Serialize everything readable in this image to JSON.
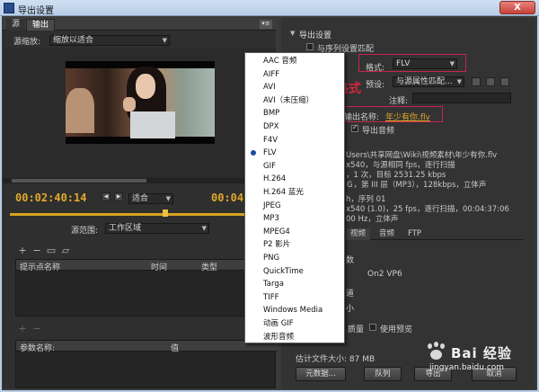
{
  "window": {
    "title": "导出设置",
    "close_label": "X"
  },
  "left": {
    "tabs": [
      "源",
      "输出"
    ],
    "source_scaling_label": "源缩放:",
    "source_scaling_value": "缩放以适合",
    "timecode_current": "00:02:40:14",
    "timecode_end": "00:04:",
    "fit_value": "适合",
    "source_range_label": "源范围:",
    "source_range_value": "工作区域",
    "cue_columns": [
      "提示点名称",
      "时间",
      "类型"
    ],
    "param_columns": [
      "参数名称:",
      "值"
    ]
  },
  "right": {
    "export_settings_title": "导出设置",
    "match_sequence_label": "与序列设置匹配",
    "format_label": "格式:",
    "format_value": "FLV",
    "preset_label": "预设:",
    "preset_value": "与源属性匹配...",
    "comment_label": "注释:",
    "output_name_label": "输出名称:",
    "output_name_value": "年少有你.flv",
    "export_audio_label": "导出音频",
    "summary_lines": [
      "Users\\共享网盘\\Wiki\\视频素材\\年少有你.flv",
      "x540，与源相同 fps，逐行扫描",
      "，1 次，目标 2531.25 kbps",
      "Ｇ，第 III 层（MP3），128kbps，立体声",
      "",
      "h，序列 01",
      "x540 (1.0)，25 fps，逐行扫描，00:04:37:06",
      "00 Hz，立体声"
    ],
    "tabs": [
      "视频",
      "音频",
      "FTP"
    ],
    "video_codec_value": "On2 VP6",
    "partial_labels": [
      "数",
      "道",
      "小"
    ],
    "max_quality_label": "质量",
    "use_preview_label": "使用预览",
    "file_size_label": "估计文件大小: 87 MB",
    "metadata_button": "元数据...",
    "queue_button": "队列",
    "export_button": "导出",
    "cancel_button": "取消"
  },
  "annotation": {
    "text": "选择视频格式"
  },
  "format_options": [
    "AAC 音频",
    "AIFF",
    "AVI",
    "AVI（未压缩）",
    "BMP",
    "DPX",
    "F4V",
    "FLV",
    "GIF",
    "H.264",
    "H.264 蓝光",
    "JPEG",
    "MP3",
    "MPEG4",
    "P2 影片",
    "PNG",
    "QuickTime",
    "Targa",
    "TIFF",
    "Windows Media",
    "动画 GIF",
    "波形音频"
  ],
  "selected_format_index": 7,
  "watermark": {
    "brand": "Bai 经验",
    "url": "jingyan.baidu.com"
  },
  "colors": {
    "accent_timecode": "#e1a928",
    "highlight_red": "#c8264d",
    "annotation_red": "#d8263f"
  }
}
